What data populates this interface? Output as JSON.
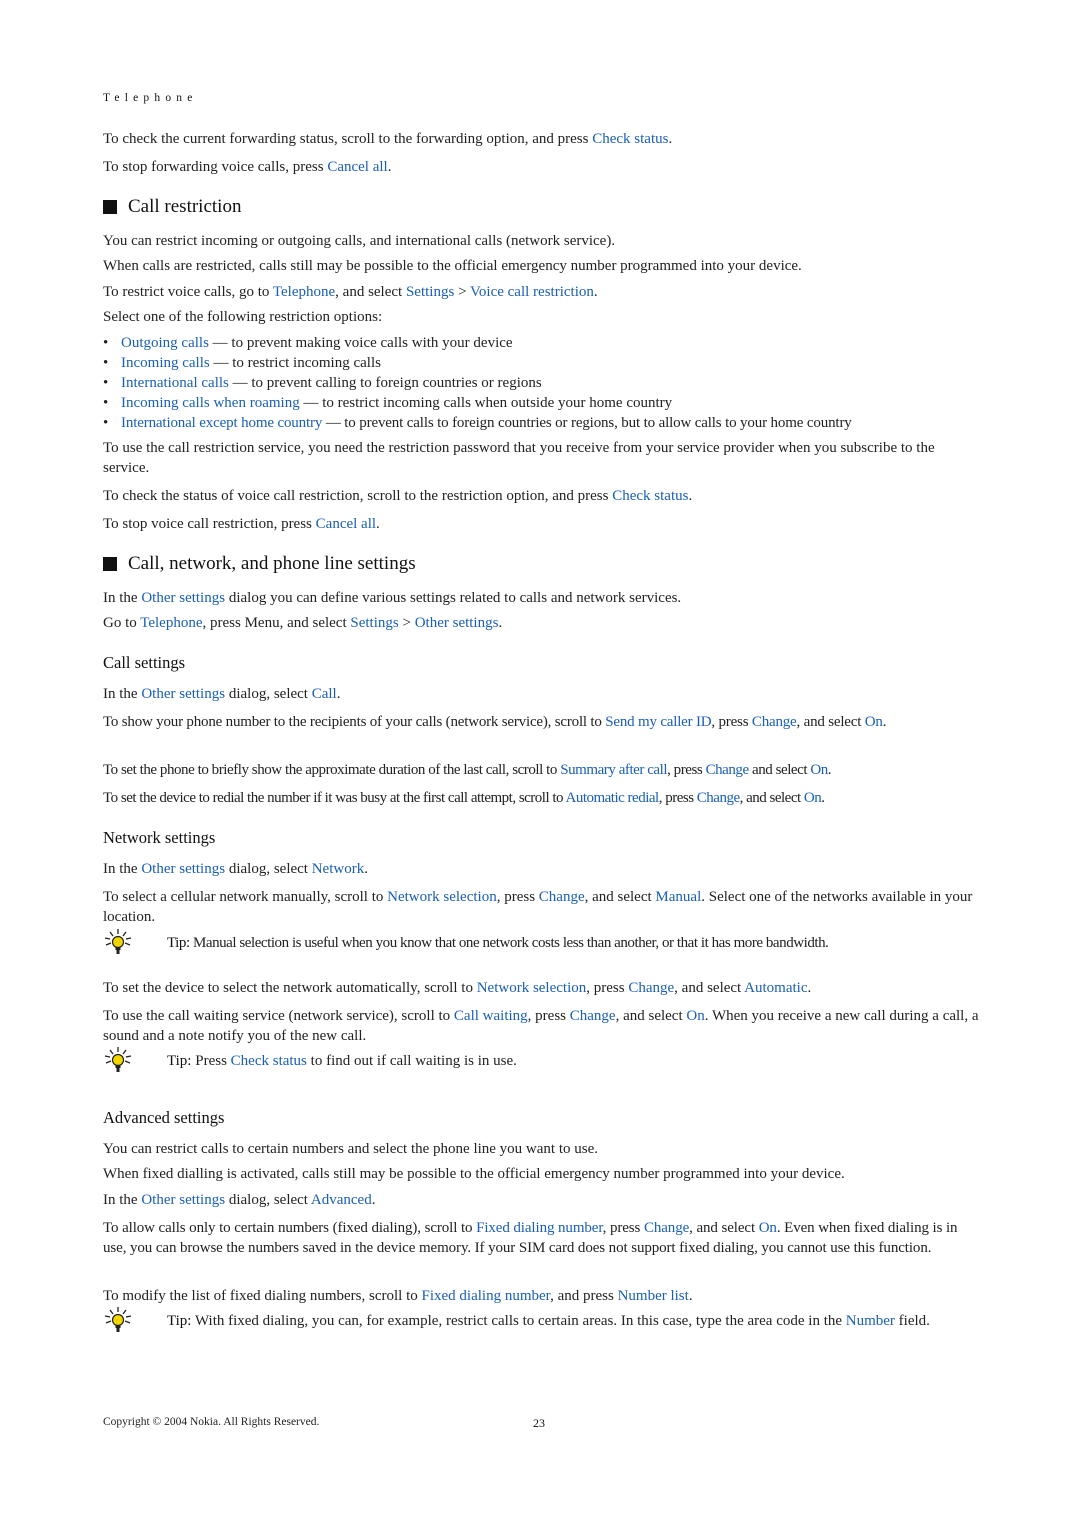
{
  "header": {
    "running_title": "Telephone"
  },
  "intro": {
    "p1": {
      "pre": "To check the current forwarding status, scroll to the forwarding option, and press ",
      "link": "Check status",
      "post": "."
    },
    "p2": {
      "pre": "To stop forwarding voice calls, press ",
      "link": "Cancel all",
      "post": "."
    }
  },
  "call_restriction": {
    "heading": "Call restriction",
    "p1": "You can restrict incoming or outgoing calls, and international calls (network service).",
    "p2": "When calls are restricted, calls still may be possible to the official emergency number programmed into your device.",
    "p3": {
      "pre": "To restrict voice calls, go to ",
      "link1": "Telephone",
      "mid": ", and select ",
      "link2": "Settings",
      "sep": " > ",
      "link3": "Voice call restriction",
      "post": "."
    },
    "p4": "Select one of the following restriction options:",
    "options": [
      {
        "name": "Outgoing calls",
        "desc": " — to prevent making voice calls with your device"
      },
      {
        "name": "Incoming calls",
        "desc": " — to restrict incoming calls"
      },
      {
        "name": "International calls",
        "desc": " — to prevent calling to foreign countries or regions"
      },
      {
        "name": "Incoming calls when roaming",
        "desc": " — to restrict incoming calls when outside your home country"
      },
      {
        "name": "International except home country",
        "desc": " — to prevent calls to foreign countries or regions, but to allow calls to your home country"
      }
    ],
    "bullet": "•",
    "p5": "To use the call restriction service, you need the restriction password that you receive from your service provider when you subscribe to the service.",
    "p6": {
      "pre": "To check the status of voice call restriction, scroll to the restriction option, and press ",
      "link": "Check status",
      "post": "."
    },
    "p7": {
      "pre": "To stop voice call restriction, press ",
      "link": "Cancel all",
      "post": "."
    }
  },
  "call_network": {
    "heading": "Call, network, and phone line settings",
    "p1": {
      "pre": "In the ",
      "link": "Other settings",
      "post": " dialog you can define various settings related to calls and network services."
    },
    "p2": {
      "pre": "Go to ",
      "link1": "Telephone",
      "mid": ", press Menu, and select ",
      "link2": "Settings",
      "sep": " > ",
      "link3": "Other settings",
      "post": "."
    }
  },
  "call_settings": {
    "heading": "Call settings",
    "p1": {
      "pre": "In the ",
      "link1": "Other settings",
      "mid": " dialog, select ",
      "link2": "Call",
      "post": "."
    },
    "p2": {
      "pre": "To show your phone number to the recipients of your calls (network service), scroll to ",
      "link1": "Send my caller ID",
      "mid1": ", press ",
      "link2": "Change",
      "mid2": ", and select ",
      "link3": "On",
      "post": "."
    },
    "p3": {
      "pre": "To set the phone to briefly show the approximate duration of the last call, scroll to ",
      "link1": "Summary after call",
      "mid1": ", press ",
      "link2": "Change",
      "mid2": " and select ",
      "link3": "On",
      "post": "."
    },
    "p4": {
      "pre": "To set the device to redial the number if it was busy at the first call attempt, scroll to ",
      "link1": "Automatic redial",
      "mid1": ", press ",
      "link2": "Change",
      "mid2": ", and select ",
      "link3": "On",
      "post": "."
    }
  },
  "network_settings": {
    "heading": "Network settings",
    "p1": {
      "pre": "In the ",
      "link1": "Other settings",
      "mid": " dialog, select ",
      "link2": "Network",
      "post": "."
    },
    "p2": {
      "pre": "To select a cellular network manually, scroll to ",
      "link1": "Network selection",
      "mid1": ", press ",
      "link2": "Change",
      "mid2": ", and select ",
      "link3": "Manual",
      "post": ". Select one of the networks available in your location."
    },
    "tip1": {
      "label": "Tip:",
      "text": " Manual selection is useful when you know that one network costs less than another, or that it has more bandwidth."
    },
    "p3": {
      "pre": "To set the device to select the network automatically, scroll to ",
      "link1": "Network selection",
      "mid1": ", press ",
      "link2": "Change",
      "mid2": ", and select ",
      "link3": "Automatic",
      "post": "."
    },
    "p4": {
      "pre": "To use the call waiting service (network service), scroll to ",
      "link1": "Call waiting",
      "mid1": ", press ",
      "link2": "Change",
      "mid2": ", and select ",
      "link3": "On",
      "post": ". When you receive a new call during a call, a sound and a note notify you of the new call."
    },
    "tip2": {
      "label": "Tip:",
      "pre": " Press ",
      "link": "Check status",
      "post": " to find out if call waiting is in use."
    }
  },
  "advanced_settings": {
    "heading": "Advanced settings",
    "p1": "You can restrict calls to certain numbers and select the phone line you want to use.",
    "p2": "When fixed dialling is activated, calls still may be possible to the official emergency number programmed into your device.",
    "p3": {
      "pre": "In the ",
      "link1": "Other settings",
      "mid": " dialog, select ",
      "link2": "Advanced",
      "post": "."
    },
    "p4": {
      "pre": "To allow calls only to certain numbers (fixed dialing), scroll to ",
      "link1": "Fixed dialing number",
      "mid1": ", press ",
      "link2": "Change",
      "mid2": ", and select ",
      "link3": "On",
      "post": ". Even when fixed dialing is in use, you can browse the numbers saved in the device memory. If your SIM card does not support fixed dialing, you cannot use this function."
    },
    "p5": {
      "pre": "To modify the list of fixed dialing numbers, scroll to ",
      "link1": "Fixed dialing number",
      "mid": ", and press ",
      "link2": "Number list",
      "post": "."
    },
    "tip": {
      "label": "Tip:",
      "pre": " With fixed dialing, you can, for example, restrict calls to certain areas. In this case, type the area code in the ",
      "link": "Number",
      "post": " field."
    }
  },
  "footer": {
    "copyright": "Copyright © 2004 Nokia. All Rights Reserved.",
    "page_number": "23"
  },
  "colors": {
    "link": "#1a5fb4",
    "text": "#222222",
    "bulb": "#f2d600"
  }
}
